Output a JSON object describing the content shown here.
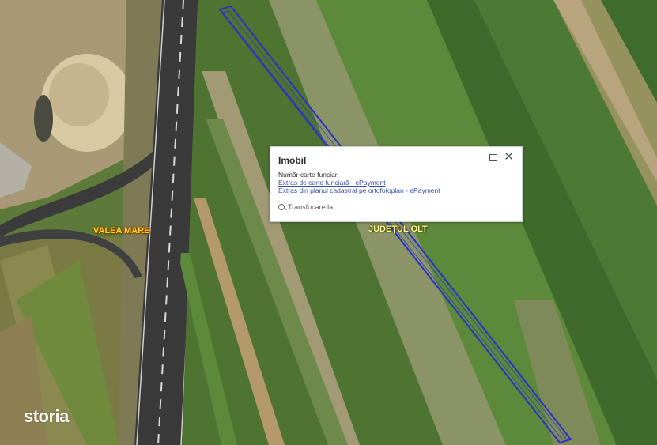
{
  "map": {
    "labels": {
      "valea_mare": "VALEA MARE",
      "judet_olt": "JUDEȚUL OLT"
    },
    "parcel_outline_color": "#2a32c8"
  },
  "popup": {
    "title": "Imobil",
    "carte_funciara": "Număr carte funciar",
    "link_extras": "Extras de carte funciară - ePayment",
    "link_plan": "Extras din planul cadastral pe ortofotoplan - ePayment",
    "zoom_label": "Transfocare la",
    "close_symbol": "✕"
  },
  "watermark": {
    "text": "storia"
  }
}
